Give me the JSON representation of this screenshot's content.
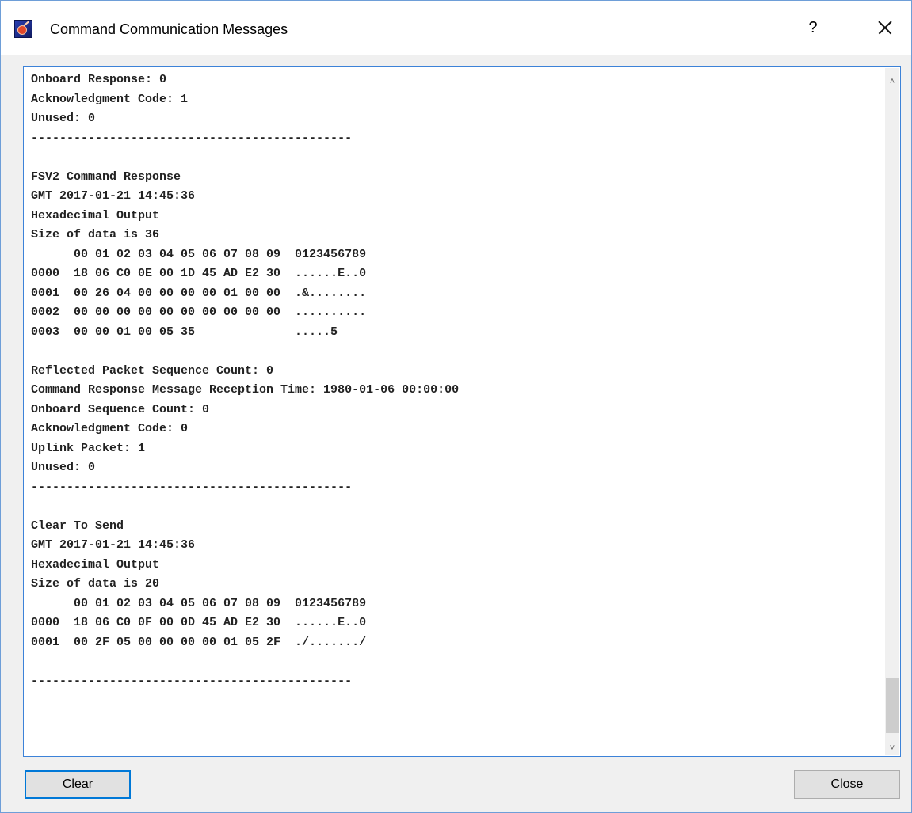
{
  "window": {
    "title": "Command Communication Messages",
    "help_label": "?",
    "accent_color": "#3c82d8"
  },
  "log": {
    "lines": [
      "Onboard Response: 0",
      "Acknowledgment Code: 1",
      "Unused: 0",
      "---------------------------------------------",
      "",
      "FSV2 Command Response",
      "GMT 2017-01-21 14:45:36",
      "Hexadecimal Output",
      "Size of data is 36",
      "      00 01 02 03 04 05 06 07 08 09  0123456789",
      "0000  18 06 C0 0E 00 1D 45 AD E2 30  ......E..0",
      "0001  00 26 04 00 00 00 00 01 00 00  .&........",
      "0002  00 00 00 00 00 00 00 00 00 00  ..........",
      "0003  00 00 01 00 05 35              .....5",
      "",
      "Reflected Packet Sequence Count: 0",
      "Command Response Message Reception Time: 1980-01-06 00:00:00",
      "Onboard Sequence Count: 0",
      "Acknowledgment Code: 0",
      "Uplink Packet: 1",
      "Unused: 0",
      "---------------------------------------------",
      "",
      "Clear To Send",
      "GMT 2017-01-21 14:45:36",
      "Hexadecimal Output",
      "Size of data is 20",
      "      00 01 02 03 04 05 06 07 08 09  0123456789",
      "0000  18 06 C0 0F 00 0D 45 AD E2 30  ......E..0",
      "0001  00 2F 05 00 00 00 00 01 05 2F  ./......./",
      "",
      "---------------------------------------------"
    ]
  },
  "buttons": {
    "clear_label": "Clear",
    "close_label": "Close"
  },
  "icons": {
    "app": "satellite-dish-icon",
    "close": "close-icon",
    "scroll_up": "chevron-up-icon",
    "scroll_down": "chevron-down-icon"
  }
}
